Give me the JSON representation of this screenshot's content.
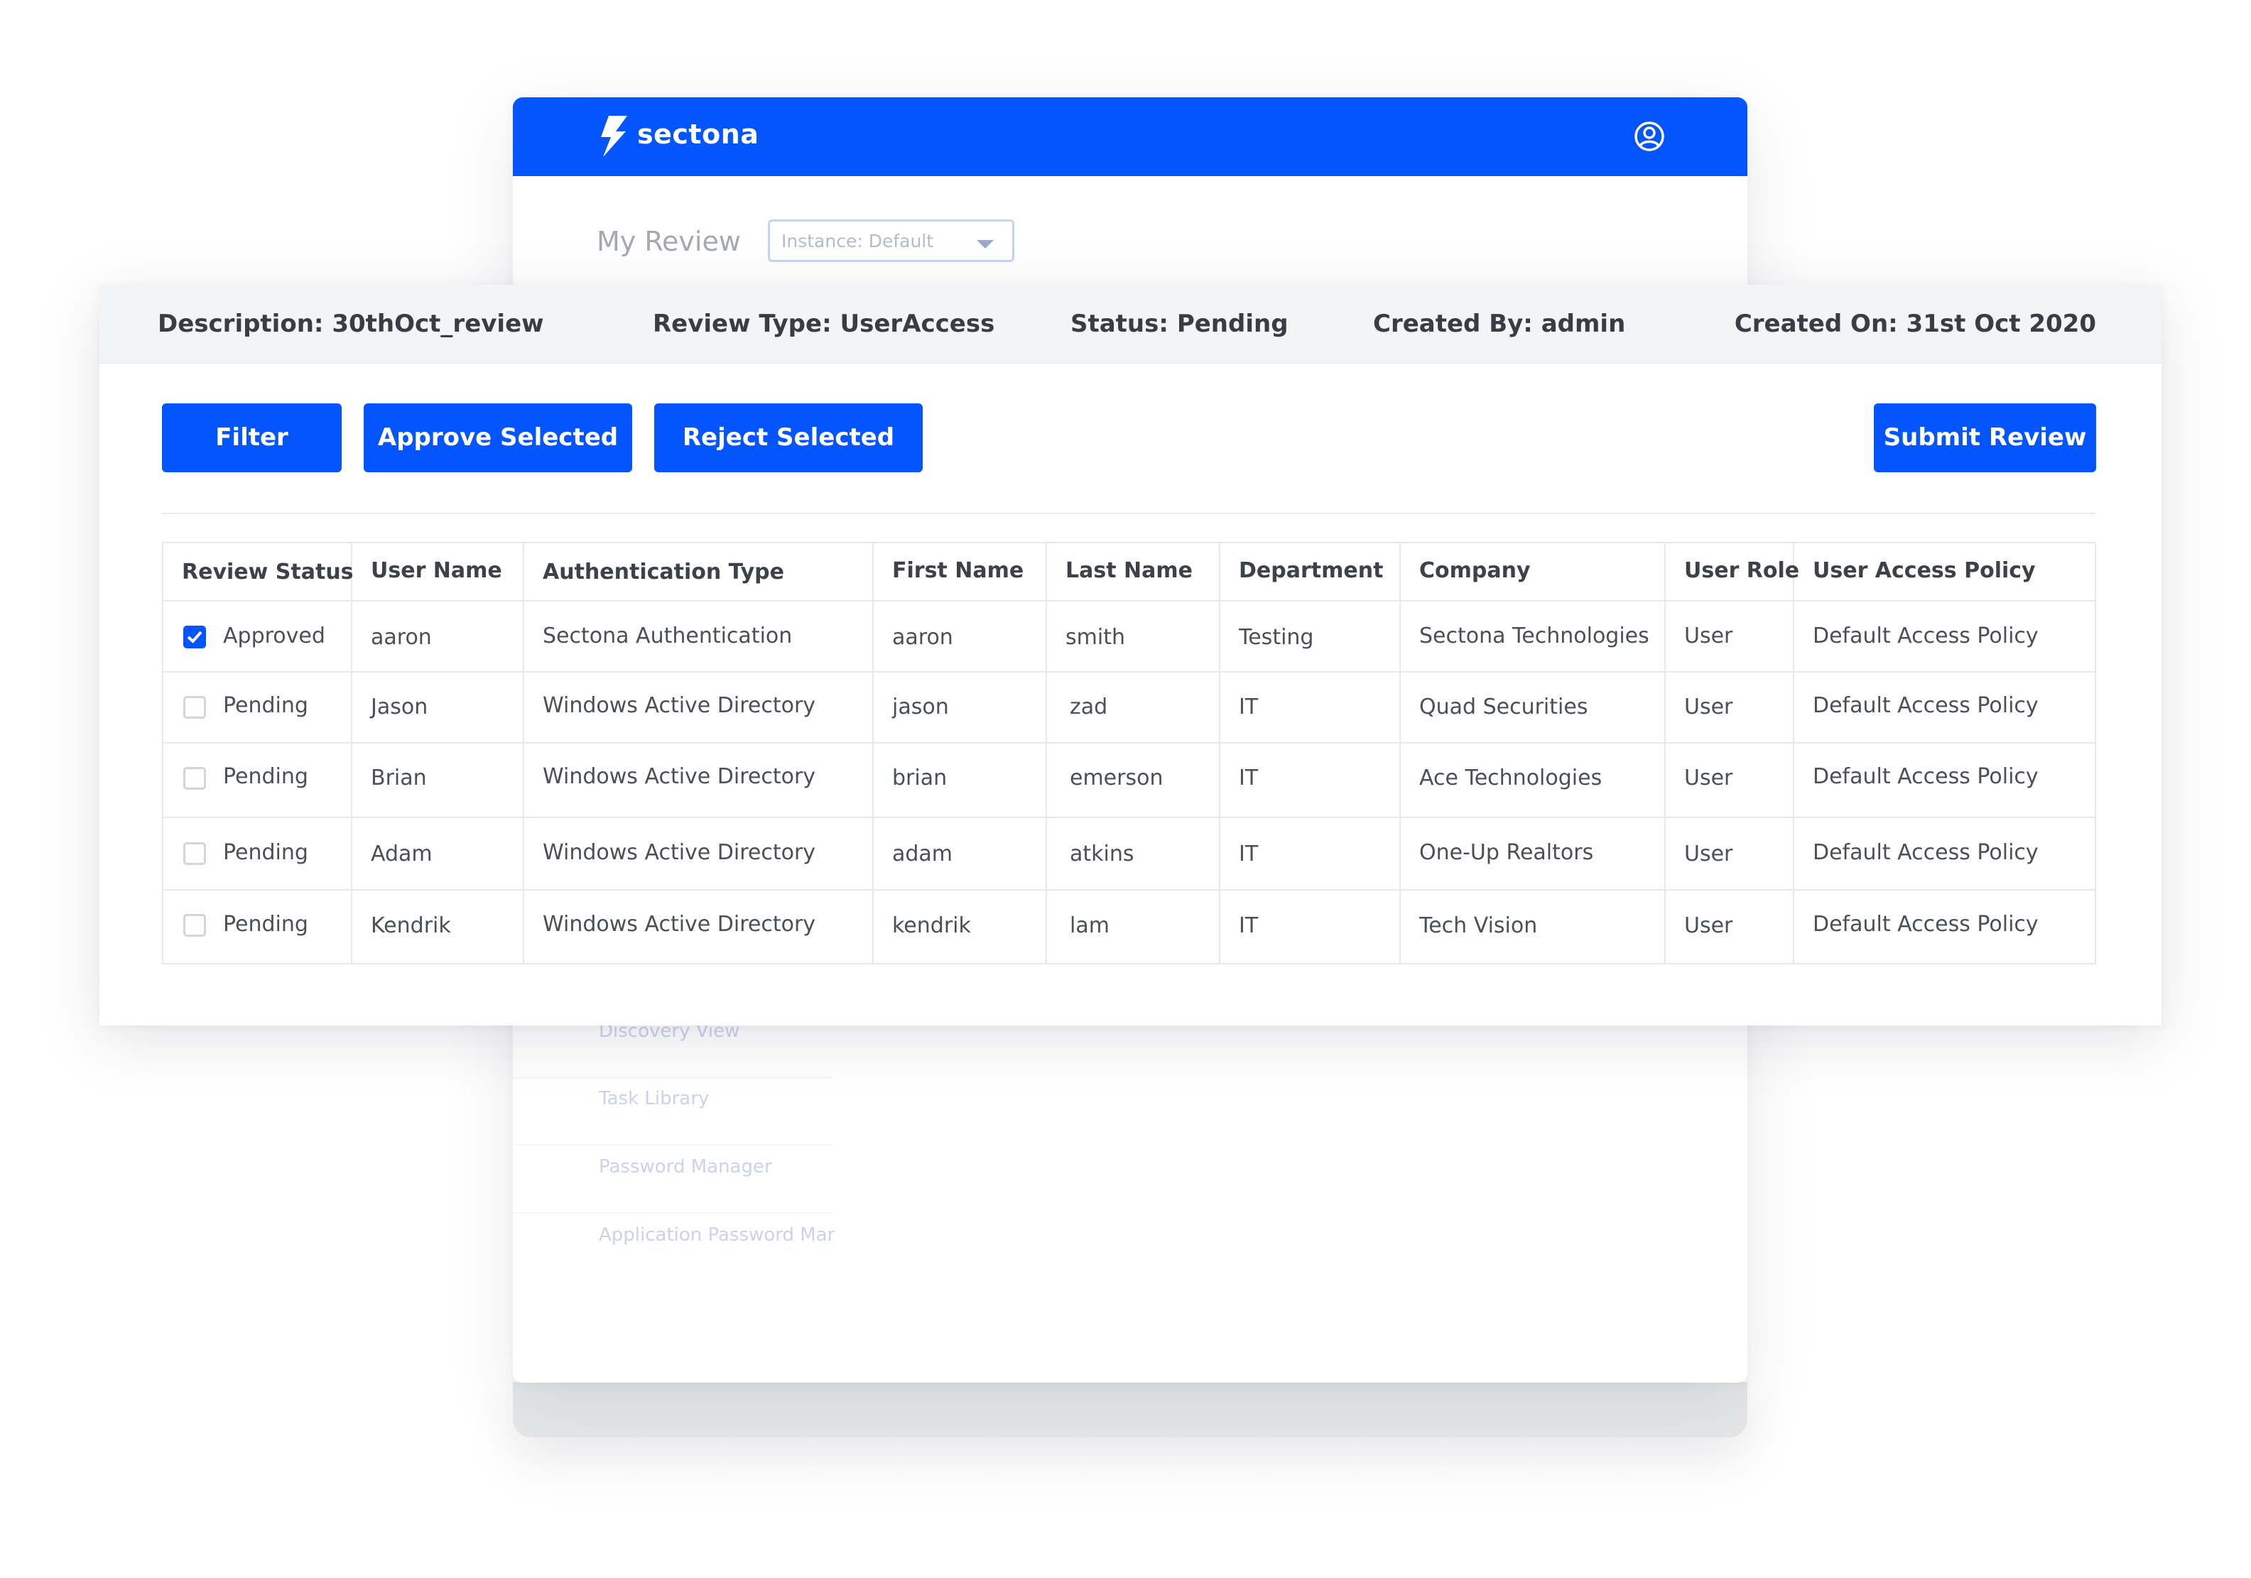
{
  "app": {
    "brand": "sectona",
    "icons": {
      "logo": "lightning-bolt-icon",
      "user": "user-circle-icon",
      "dropdown": "chevron-down-icon",
      "checked": "check-icon"
    },
    "colors": {
      "primary": "#0455fd",
      "header_bg": "#0455fd",
      "info_bar_bg": "#f3f4f5"
    }
  },
  "page": {
    "title": "My Review",
    "instance_select": {
      "value": "Instance: Default"
    }
  },
  "sidebar": {
    "items": [
      {
        "label": "Discovery View"
      },
      {
        "label": "Task Library"
      },
      {
        "label": "Password Manager"
      },
      {
        "label": "Application Password Mar"
      }
    ]
  },
  "review_info": {
    "description": "Description: 30thOct_review",
    "review_type": "Review Type: UserAccess",
    "status": "Status: Pending",
    "created_by": "Created By: admin",
    "created_on": "Created On: 31st Oct 2020"
  },
  "toolbar": {
    "filter_label": "Filter",
    "approve_label": "Approve Selected",
    "reject_label": "Reject Selected",
    "submit_label": "Submit Review"
  },
  "table": {
    "columns": [
      "Review Status",
      "User Name",
      "Authentication Type",
      "First Name",
      "Last Name",
      "Department",
      "Company",
      "User Role",
      "User Access Policy"
    ],
    "rows": [
      {
        "checked": true,
        "status": "Approved",
        "user_name": "aaron",
        "auth_type": "Sectona Authentication",
        "first_name": "aaron",
        "last_name": "smith",
        "department": "Testing",
        "company": "Sectona Technologies",
        "role": "User",
        "policy": "Default Access Policy"
      },
      {
        "checked": false,
        "status": "Pending",
        "user_name": "Jason",
        "auth_type": "Windows Active Directory",
        "first_name": "jason",
        "last_name": "zad",
        "department": "IT",
        "company": "Quad Securities",
        "role": "User",
        "policy": "Default Access Policy"
      },
      {
        "checked": false,
        "status": "Pending",
        "user_name": "Brian",
        "auth_type": "Windows Active Directory",
        "first_name": "brian",
        "last_name": "emerson",
        "department": "IT",
        "company": "Ace Technologies",
        "role": "User",
        "policy": "Default Access Policy"
      },
      {
        "checked": false,
        "status": "Pending",
        "user_name": "Adam",
        "auth_type": "Windows Active Directory",
        "first_name": "adam",
        "last_name": "atkins",
        "department": "IT",
        "company": "One-Up Realtors",
        "role": "User",
        "policy": "Default Access Policy"
      },
      {
        "checked": false,
        "status": "Pending",
        "user_name": "Kendrik",
        "auth_type": "Windows Active Directory",
        "first_name": "kendrik",
        "last_name": "lam",
        "department": "IT",
        "company": "Tech Vision",
        "role": "User",
        "policy": "Default Access Policy"
      }
    ]
  }
}
